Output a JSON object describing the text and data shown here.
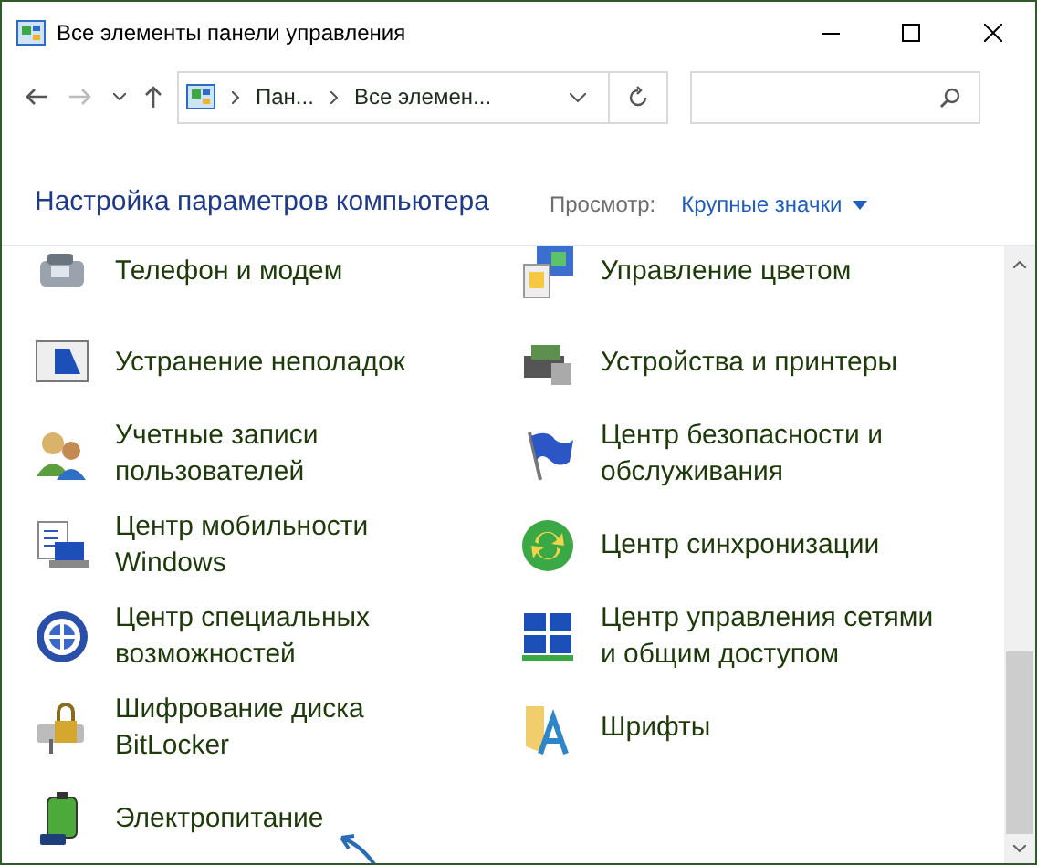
{
  "window": {
    "title": "Все элементы панели управления"
  },
  "address_bar": {
    "crumbs": [
      "Пан...",
      "Все элемен..."
    ]
  },
  "header": {
    "title": "Настройка параметров компьютера",
    "view_label": "Просмотр:",
    "view_value": "Крупные значки"
  },
  "items": [
    {
      "label": "Телефон и модем"
    },
    {
      "label": "Управление цветом"
    },
    {
      "label": "Устранение неполадок"
    },
    {
      "label": "Устройства и принтеры"
    },
    {
      "label": "Учетные записи пользователей"
    },
    {
      "label": "Центр безопасности и обслуживания"
    },
    {
      "label": "Центр мобильности Windows"
    },
    {
      "label": "Центр синхронизации"
    },
    {
      "label": "Центр специальных возможностей"
    },
    {
      "label": "Центр управления сетями и общим доступом"
    },
    {
      "label": "Шифрование диска BitLocker"
    },
    {
      "label": "Шрифты"
    },
    {
      "label": "Электропитание"
    }
  ]
}
